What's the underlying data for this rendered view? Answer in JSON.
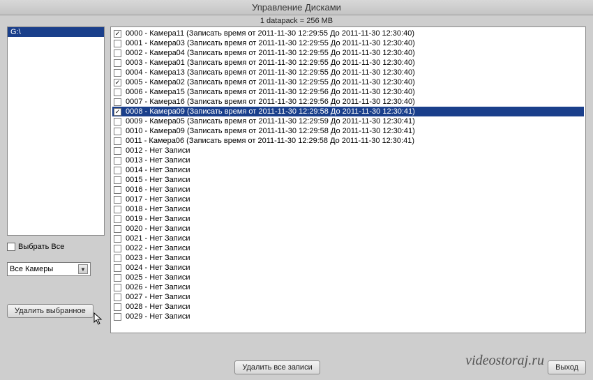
{
  "title": "Управление Дисками",
  "info": "1 datapack = 256 MB",
  "drive": "G:\\",
  "selectAllLabel": "Выбрать Все",
  "cameraFilter": "Все Камеры",
  "btnDeleteSelected": "Удалить выбранное",
  "btnDeleteAll": "Удалить все записи",
  "btnExit": "Выход",
  "watermark": "videostoraj.ru",
  "rows": [
    {
      "checked": true,
      "idx": "0000",
      "cam": "Камера11",
      "rec": "(Записать время от 2011-11-30 12:29:55 До 2011-11-30 12:30:40)"
    },
    {
      "checked": false,
      "idx": "0001",
      "cam": "Камера03",
      "rec": "(Записать время от 2011-11-30 12:29:55 До 2011-11-30 12:30:40)"
    },
    {
      "checked": false,
      "idx": "0002",
      "cam": "Камера04",
      "rec": "(Записать время от 2011-11-30 12:29:55 До 2011-11-30 12:30:40)"
    },
    {
      "checked": false,
      "idx": "0003",
      "cam": "Камера01",
      "rec": "(Записать время от 2011-11-30 12:29:55 До 2011-11-30 12:30:40)"
    },
    {
      "checked": false,
      "idx": "0004",
      "cam": "Камера13",
      "rec": "(Записать время от 2011-11-30 12:29:55 До 2011-11-30 12:30:40)"
    },
    {
      "checked": true,
      "idx": "0005",
      "cam": "Камера02",
      "rec": "(Записать время от 2011-11-30 12:29:55 До 2011-11-30 12:30:40)"
    },
    {
      "checked": false,
      "idx": "0006",
      "cam": "Камера15",
      "rec": "(Записать время от 2011-11-30 12:29:56 До 2011-11-30 12:30:40)"
    },
    {
      "checked": false,
      "idx": "0007",
      "cam": "Камера16",
      "rec": "(Записать время от 2011-11-30 12:29:56 До 2011-11-30 12:30:40)"
    },
    {
      "checked": true,
      "selected": true,
      "idx": "0008",
      "cam": "Камера09",
      "rec": "(Записать время от 2011-11-30 12:29:58 До 2011-11-30 12:30:41)"
    },
    {
      "checked": false,
      "idx": "0009",
      "cam": "Камера05",
      "rec": "(Записать время от 2011-11-30 12:29:59 До 2011-11-30 12:30:41)"
    },
    {
      "checked": false,
      "idx": "0010",
      "cam": "Камера09",
      "rec": "(Записать время от 2011-11-30 12:29:58 До 2011-11-30 12:30:41)"
    },
    {
      "checked": false,
      "idx": "0011",
      "cam": "Камера06",
      "rec": "(Записать время от 2011-11-30 12:29:58 До 2011-11-30 12:30:41)"
    },
    {
      "checked": false,
      "idx": "0012",
      "cam": "Нет Записи",
      "rec": ""
    },
    {
      "checked": false,
      "idx": "0013",
      "cam": "Нет Записи",
      "rec": ""
    },
    {
      "checked": false,
      "idx": "0014",
      "cam": "Нет Записи",
      "rec": ""
    },
    {
      "checked": false,
      "idx": "0015",
      "cam": "Нет Записи",
      "rec": ""
    },
    {
      "checked": false,
      "idx": "0016",
      "cam": "Нет Записи",
      "rec": ""
    },
    {
      "checked": false,
      "idx": "0017",
      "cam": "Нет Записи",
      "rec": ""
    },
    {
      "checked": false,
      "idx": "0018",
      "cam": "Нет Записи",
      "rec": ""
    },
    {
      "checked": false,
      "idx": "0019",
      "cam": "Нет Записи",
      "rec": ""
    },
    {
      "checked": false,
      "idx": "0020",
      "cam": "Нет Записи",
      "rec": ""
    },
    {
      "checked": false,
      "idx": "0021",
      "cam": "Нет Записи",
      "rec": ""
    },
    {
      "checked": false,
      "idx": "0022",
      "cam": "Нет Записи",
      "rec": ""
    },
    {
      "checked": false,
      "idx": "0023",
      "cam": "Нет Записи",
      "rec": ""
    },
    {
      "checked": false,
      "idx": "0024",
      "cam": "Нет Записи",
      "rec": ""
    },
    {
      "checked": false,
      "idx": "0025",
      "cam": "Нет Записи",
      "rec": ""
    },
    {
      "checked": false,
      "idx": "0026",
      "cam": "Нет Записи",
      "rec": ""
    },
    {
      "checked": false,
      "idx": "0027",
      "cam": "Нет Записи",
      "rec": ""
    },
    {
      "checked": false,
      "idx": "0028",
      "cam": "Нет Записи",
      "rec": ""
    },
    {
      "checked": false,
      "idx": "0029",
      "cam": "Нет Записи",
      "rec": ""
    }
  ]
}
